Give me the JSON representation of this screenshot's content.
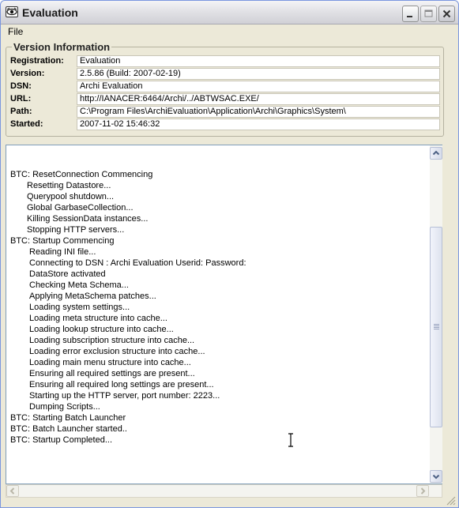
{
  "window": {
    "title": "Evaluation",
    "icons": {
      "app": "eye-icon",
      "minimize": "minimize-icon",
      "maximize": "maximize-icon",
      "close": "close-icon"
    }
  },
  "menu": {
    "items": [
      "File"
    ]
  },
  "version_info": {
    "title": "Version Information",
    "fields": [
      {
        "label": "Registration:",
        "value": "Evaluation"
      },
      {
        "label": "Version:",
        "value": "2.5.86 (Build: 2007-02-19)"
      },
      {
        "label": "DSN:",
        "value": "Archi Evaluation"
      },
      {
        "label": "URL:",
        "value": "http://IANACER:6464/Archi/../ABTWSAC.EXE/"
      },
      {
        "label": "Path:",
        "value": "C:\\Program Files\\ArchiEvaluation\\Application\\Archi\\Graphics\\System\\"
      },
      {
        "label": "Started:",
        "value": "2007-11-02 15:46:32"
      }
    ]
  },
  "log": {
    "lines": [
      {
        "text": "BTC: ResetConnection Commencing",
        "level": 0
      },
      {
        "text": "Resetting Datastore...",
        "level": 1
      },
      {
        "text": "Querypool shutdown...",
        "level": 1
      },
      {
        "text": "Global GarbaseCollection...",
        "level": 1
      },
      {
        "text": "Killing SessionData instances...",
        "level": 1
      },
      {
        "text": "Stopping HTTP servers...",
        "level": 1
      },
      {
        "text": "BTC: Startup Commencing",
        "level": 0
      },
      {
        "text": "Reading INI file...",
        "level": 2
      },
      {
        "text": "Connecting to DSN : Archi Evaluation Userid:  Password:",
        "level": 2
      },
      {
        "text": "DataStore activated",
        "level": 2
      },
      {
        "text": "Checking Meta Schema...",
        "level": 2
      },
      {
        "text": "Applying MetaSchema patches...",
        "level": 2
      },
      {
        "text": "Loading system settings...",
        "level": 2
      },
      {
        "text": "Loading meta structure into cache...",
        "level": 2
      },
      {
        "text": "Loading lookup structure into cache...",
        "level": 2
      },
      {
        "text": "Loading subscription structure into cache...",
        "level": 2
      },
      {
        "text": "Loading error exclusion structure into cache...",
        "level": 2
      },
      {
        "text": "Loading main menu structure into cache...",
        "level": 2
      },
      {
        "text": "Ensuring all required settings are present...",
        "level": 2
      },
      {
        "text": "Ensuring all required long settings are present...",
        "level": 2
      },
      {
        "text": "Starting up the HTTP server, port number: 2223...",
        "level": 2
      },
      {
        "text": "Dumping Scripts...",
        "level": 2
      },
      {
        "text": "BTC: Starting Batch Launcher",
        "level": 0
      },
      {
        "text": "BTC: Batch Launcher started..",
        "level": 0
      },
      {
        "text": "BTC: Startup Completed...",
        "level": 0
      }
    ]
  },
  "scrollbar": {
    "vertical_position": 0.62
  }
}
